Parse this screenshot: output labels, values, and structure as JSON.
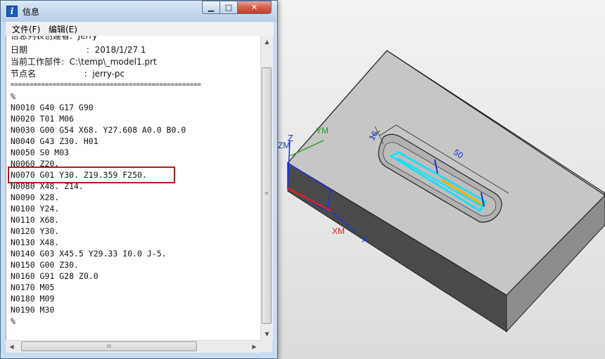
{
  "window": {
    "title": "信息",
    "icon": "info-icon",
    "controls": {
      "minimize": "▁",
      "maximize": "□",
      "close": "✕"
    }
  },
  "menubar": {
    "file": "文件(F)",
    "edit": "编辑(E)"
  },
  "header_lines": [
    "信息列表创建者:  Jerry",
    "日期                      :  2018/1/27 1",
    "当前工作部件:  C:\\temp\\_model1.prt",
    "节点名                  :  jerry-pc",
    "=================================================="
  ],
  "nc_lines": [
    "%",
    "N0010 G40 G17 G90",
    "N0020 T01 M06",
    "N0030 G00 G54 X68. Y27.608 A0.0 B0.0",
    "N0040 G43 Z30. H01",
    "N0050 S0 M03",
    "N0060 Z20.",
    "N0070 G01 Y30. Z19.359 F250.",
    "N0080 X48. Z14.",
    "N0090 X28.",
    "N0100 Y24.",
    "N0110 X68.",
    "N0120 Y30.",
    "N0130 X48.",
    "N0140 G03 X45.5 Y29.33 I0.0 J-5.",
    "N0150 G00 Z30.",
    "N0160 G91 G28 Z0.0",
    "N0170 M05",
    "N0180 M09",
    "N0190 M30",
    "%"
  ],
  "highlighted_line_index": 7,
  "scrollbars": {
    "up": "▲",
    "down": "▼",
    "left": "◀",
    "right": "▶",
    "grip": "III",
    "vgrip": "≡"
  },
  "viewport": {
    "axis_labels": {
      "zm": "ZM",
      "ym": "YM",
      "xm": "XM",
      "z": "Z",
      "x": "X"
    },
    "dimensions": {
      "width": "16",
      "length": "50"
    },
    "colors": {
      "toolpath": "#00e5ff",
      "axis_x": "#e02020",
      "axis_y": "#2aa02a",
      "axis_z": "#1a36d6",
      "highlight": "#b01e1e"
    }
  }
}
